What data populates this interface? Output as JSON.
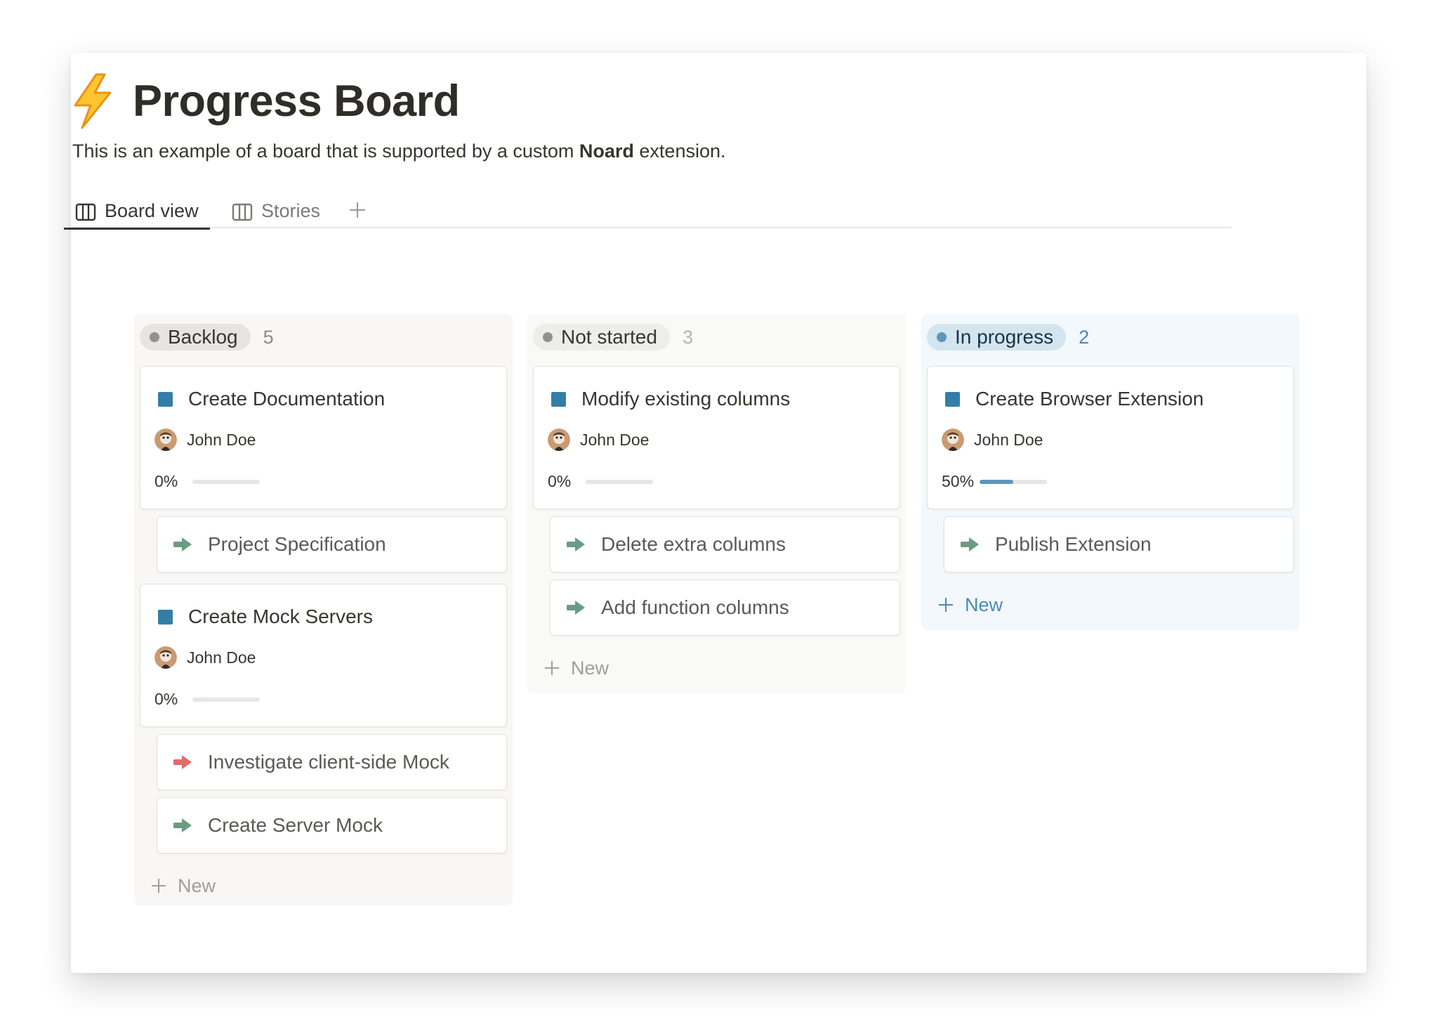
{
  "page": {
    "title": "Progress Board",
    "title_icon": "lightning-bolt-icon",
    "description_before": "This is an example of a board that is supported by a custom ",
    "description_bold": "Noard",
    "description_after": " extension."
  },
  "tabs": [
    {
      "label": "Board view",
      "icon": "board-icon",
      "active": true
    },
    {
      "label": "Stories",
      "icon": "board-icon",
      "active": false
    }
  ],
  "add_view_icon": "plus-icon",
  "colors": {
    "accent_blue": "#337ea9",
    "progress_fill": "#5b97bd",
    "arrow_green": "#6a9c83",
    "arrow_red": "#e06c6c"
  },
  "columns": [
    {
      "id": "backlog",
      "status": "Backlog",
      "count": "5",
      "dot_color": "#91918e",
      "count_color": "#8c8b87",
      "new_label": "New",
      "cards": [
        {
          "title": "Create Documentation",
          "person": "John Doe",
          "progress_text": "0%",
          "progress": 0,
          "subtasks": [
            {
              "title": "Project Specification",
              "arrow": "green"
            }
          ]
        },
        {
          "title": "Create Mock Servers",
          "person": "John Doe",
          "progress_text": "0%",
          "progress": 0,
          "subtasks": [
            {
              "title": "Investigate client-side Mock",
              "arrow": "red"
            },
            {
              "title": "Create Server Mock",
              "arrow": "green"
            }
          ]
        }
      ]
    },
    {
      "id": "notstarted",
      "status": "Not started",
      "count": "3",
      "dot_color": "#91918e",
      "count_color": "#b4b3af",
      "new_label": "New",
      "cards": [
        {
          "title": "Modify existing columns",
          "person": "John Doe",
          "progress_text": "0%",
          "progress": 0,
          "subtasks": [
            {
              "title": "Delete extra columns",
              "arrow": "green"
            },
            {
              "title": "Add function columns",
              "arrow": "green"
            }
          ]
        }
      ]
    },
    {
      "id": "inprogress",
      "status": "In progress",
      "count": "2",
      "dot_color": "#5b97bd",
      "count_color": "#4a89b1",
      "new_label": "New",
      "cards": [
        {
          "title": "Create Browser Extension",
          "person": "John Doe",
          "progress_text": "50%",
          "progress": 0.5,
          "subtasks": [
            {
              "title": "Publish Extension",
              "arrow": "green"
            }
          ]
        }
      ]
    }
  ]
}
